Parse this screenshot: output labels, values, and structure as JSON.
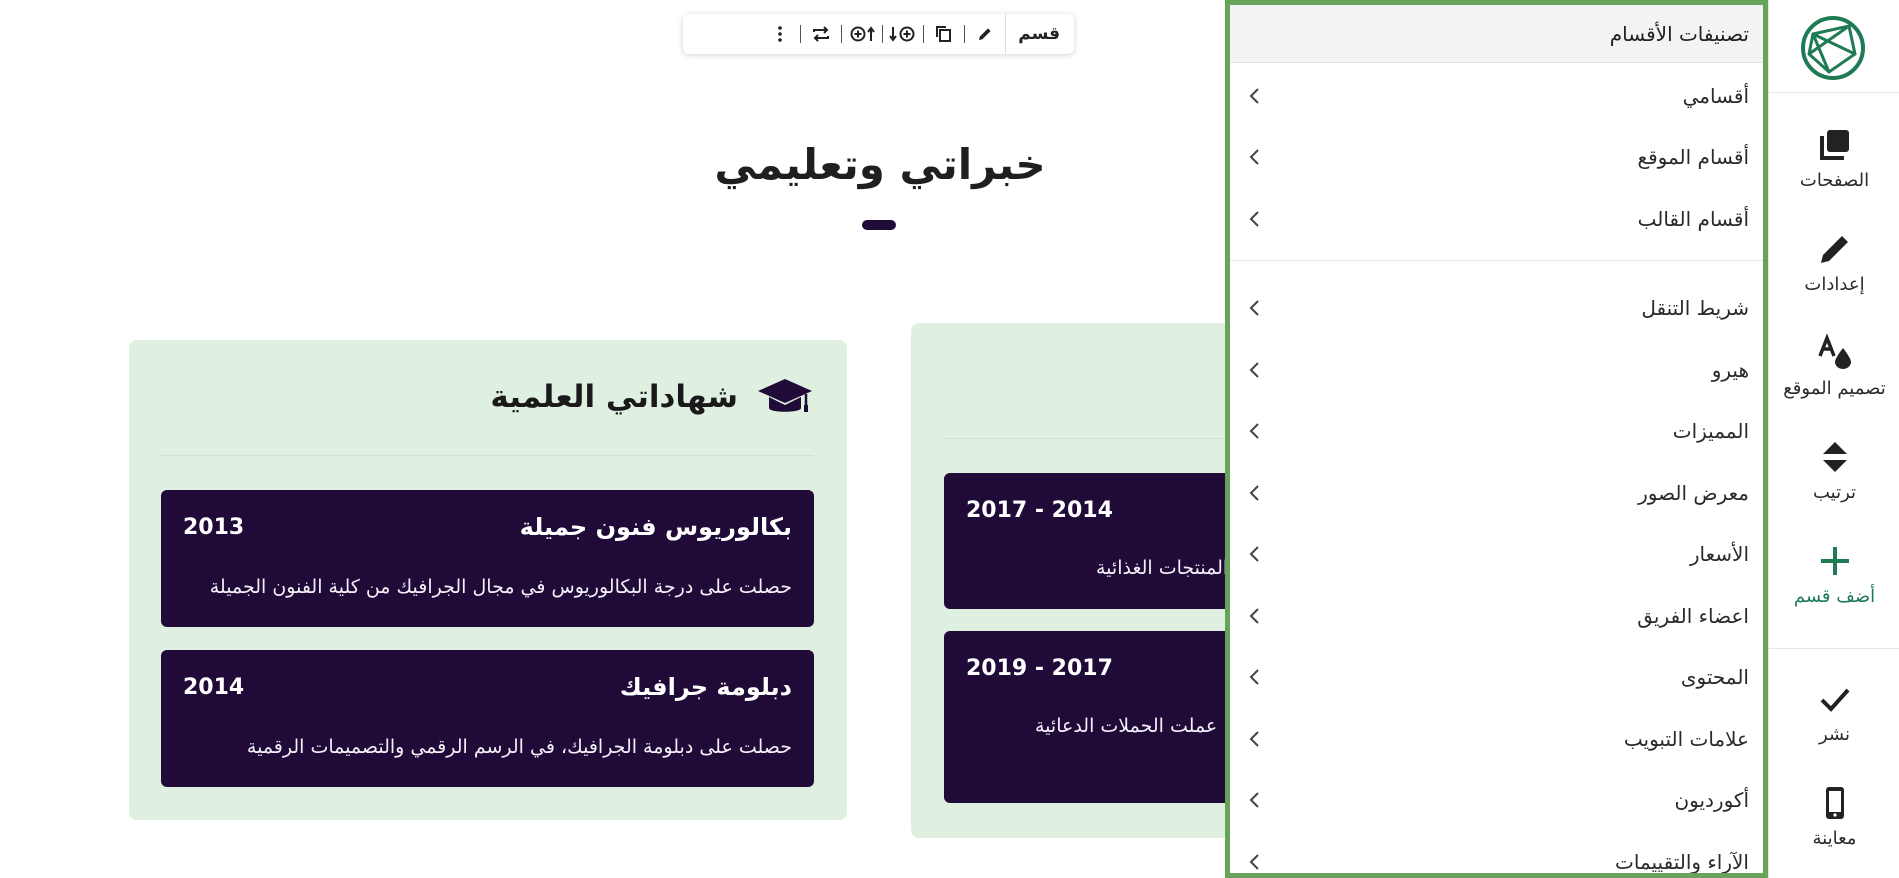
{
  "toolbar": {
    "label": "قسم"
  },
  "section": {
    "title": "خبراتي وتعليمي",
    "columns": [
      {
        "title": "شهاداتي العلمية",
        "cards": [
          {
            "title": "بكالوريوس فنون جميلة",
            "year": "2013",
            "desc": "حصلت على درجة البكالوريوس في مجال الجرافيك من كلية الفنون الجميلة"
          },
          {
            "title": "دبلومة جرافيك",
            "year": "2014",
            "desc": "حصلت على دبلومة الجرافيك، في الرسم الرقمي والتصميمات الرقمية"
          }
        ]
      },
      {
        "cards": [
          {
            "year": "2017 - 2014",
            "desc": "المنتجات الغذائية"
          },
          {
            "year": "2019 - 2017",
            "desc": "عملت الحملات الدعائية"
          }
        ]
      }
    ]
  },
  "panel": {
    "header": "تصنيفات الأقسام",
    "group1": [
      "أقسامي",
      "أقسام الموقع",
      "أقسام القالب"
    ],
    "group2": [
      "شريط التنقل",
      "هيرو",
      "المميزات",
      "معرض الصور",
      "الأسعار",
      "اعضاء الفريق",
      "المحتوى",
      "علامات التبويب",
      "أكورديون",
      "الآراء والتقييمات"
    ]
  },
  "sidebar": {
    "pages": "الصفحات",
    "settings": "إعدادات",
    "design": "تصميم الموقع",
    "order": "ترتيب",
    "add": "أضف قسم",
    "publish": "نشر",
    "preview": "معاينة"
  },
  "colors": {
    "accent": "#1e7b54",
    "panel_border": "#67a35a",
    "card_bg": "#1f0a38",
    "column_bg": "#e0f0e0"
  }
}
